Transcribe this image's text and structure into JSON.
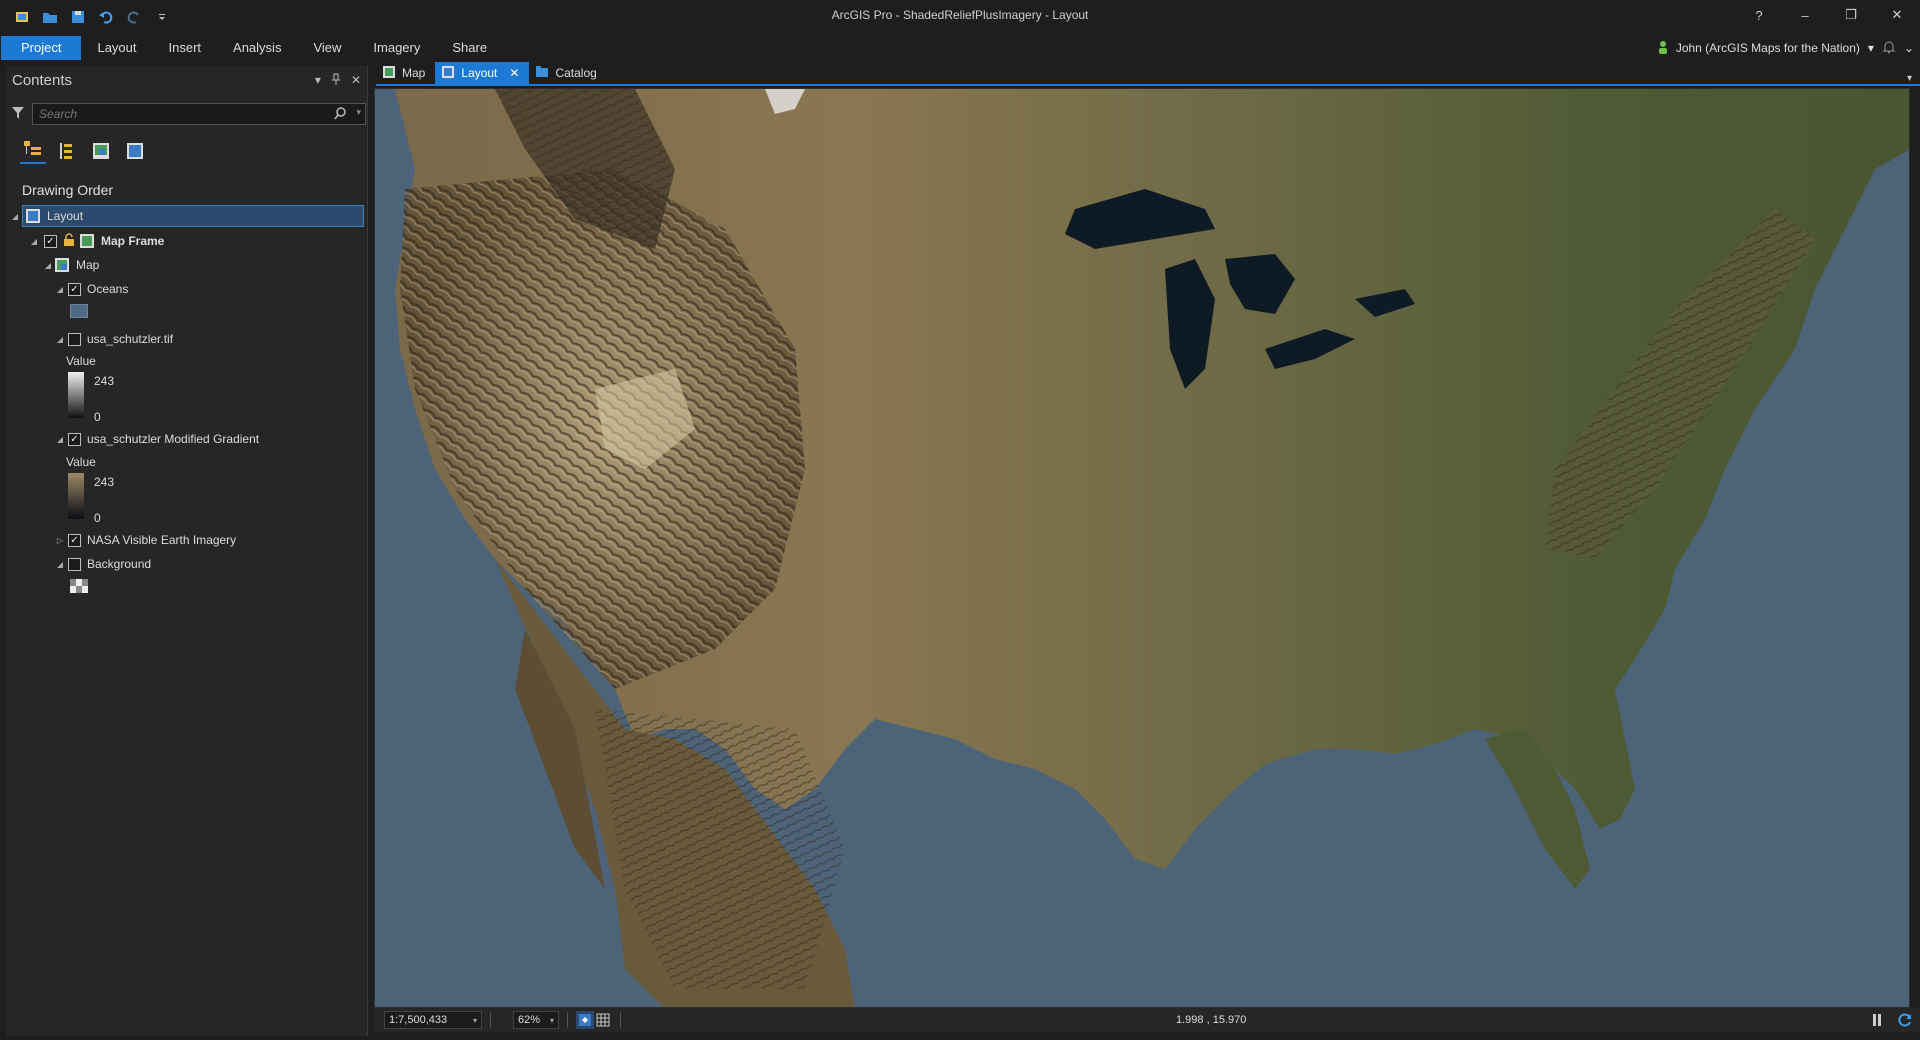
{
  "app": {
    "title": "ArcGIS Pro - ShadedReliefPlusImagery - Layout",
    "help": "?",
    "minimize": "–",
    "restore": "❐",
    "close": "✕"
  },
  "ribbon": {
    "tabs": [
      "Project",
      "Layout",
      "Insert",
      "Analysis",
      "View",
      "Imagery",
      "Share"
    ],
    "user": "John (ArcGIS Maps for the Nation)"
  },
  "contents": {
    "title": "Contents",
    "search_placeholder": "Search",
    "drawing_order": "Drawing Order",
    "items": {
      "layout": "Layout",
      "map_frame": "Map Frame",
      "map": "Map",
      "oceans": "Oceans",
      "usa_tif": "usa_schutzler.tif",
      "usa_tif_value": "Value",
      "usa_tif_high": "243",
      "usa_tif_low": "0",
      "usa_mod": "usa_schutzler Modified Gradient",
      "usa_mod_value": "Value",
      "usa_mod_high": "243",
      "usa_mod_low": "0",
      "nasa": "NASA Visible Earth Imagery",
      "background": "Background"
    }
  },
  "doctabs": {
    "map": "Map",
    "layout": "Layout",
    "catalog": "Catalog"
  },
  "status": {
    "scale": "1:7,500,433",
    "zoom": "62%",
    "coords": "1.998 , 15.970"
  },
  "colors": {
    "accent": "#1c7ad4",
    "ocean": "#4d6478",
    "oceans_swatch": "#4f6b84"
  }
}
